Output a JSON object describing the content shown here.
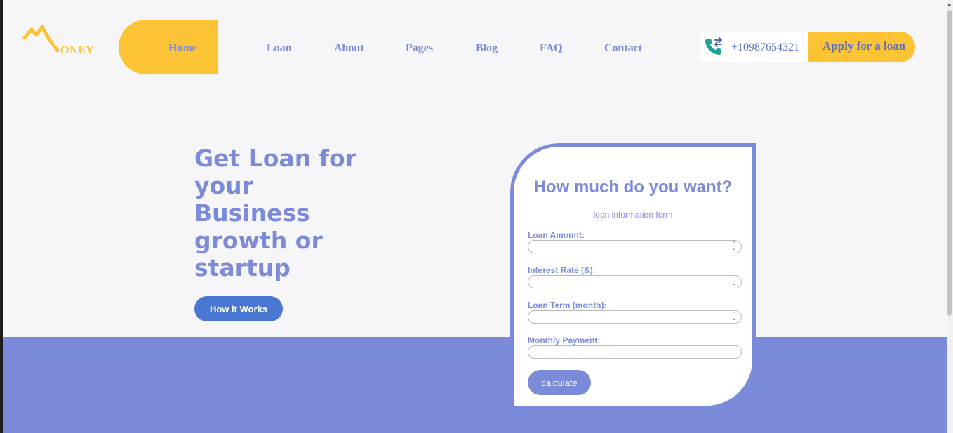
{
  "brand": {
    "logo_text": "ONEY"
  },
  "nav": {
    "items": [
      {
        "label": "Home"
      },
      {
        "label": "Loan"
      },
      {
        "label": "About"
      },
      {
        "label": "Pages"
      },
      {
        "label": "Blog"
      },
      {
        "label": "FAQ"
      },
      {
        "label": "Contact"
      }
    ]
  },
  "contact": {
    "phone": "+10987654321"
  },
  "header": {
    "apply_label": "Apply for a loan"
  },
  "hero": {
    "title": "Get Loan for your Business growth or startup",
    "cta_label": "How it Works"
  },
  "form": {
    "title": "How much do you want?",
    "subtitle": "loan information form",
    "fields": [
      {
        "label": "Loan Amount:",
        "value": "",
        "type": "number"
      },
      {
        "label": "Interest Rate (&):",
        "value": "",
        "type": "number"
      },
      {
        "label": "Loan Term (month):",
        "value": "",
        "type": "number"
      },
      {
        "label": "Monthly Payment:",
        "value": "",
        "type": "text"
      }
    ],
    "submit_label": "calculate"
  },
  "colors": {
    "primary": "#7b8bd9",
    "accent": "#fcc434",
    "button_blue": "#4a77d1",
    "background": "#f6f6f8"
  },
  "icons": {
    "logo": "money-m-logo-icon",
    "phone": "phone-transfer-icon"
  }
}
